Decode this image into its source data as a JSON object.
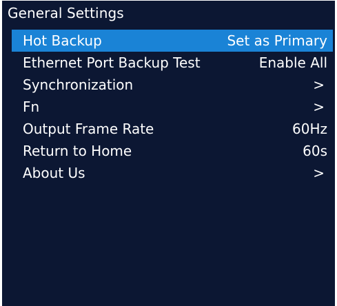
{
  "colors": {
    "background": "#0c1733",
    "highlight": "#1a83d6",
    "text": "#ffffff"
  },
  "header": {
    "title": "General Settings"
  },
  "menu": {
    "items": [
      {
        "label": "Hot Backup",
        "value": "Set as Primary",
        "selected": true
      },
      {
        "label": "Ethernet Port Backup Test",
        "value": "Enable All"
      },
      {
        "label": "Synchronization",
        "value": ">"
      },
      {
        "label": "Fn",
        "value": ">"
      },
      {
        "label": "Output Frame Rate",
        "value": "60Hz"
      },
      {
        "label": "Return to Home",
        "value": "60s"
      },
      {
        "label": "About Us",
        "value": ">"
      }
    ]
  }
}
